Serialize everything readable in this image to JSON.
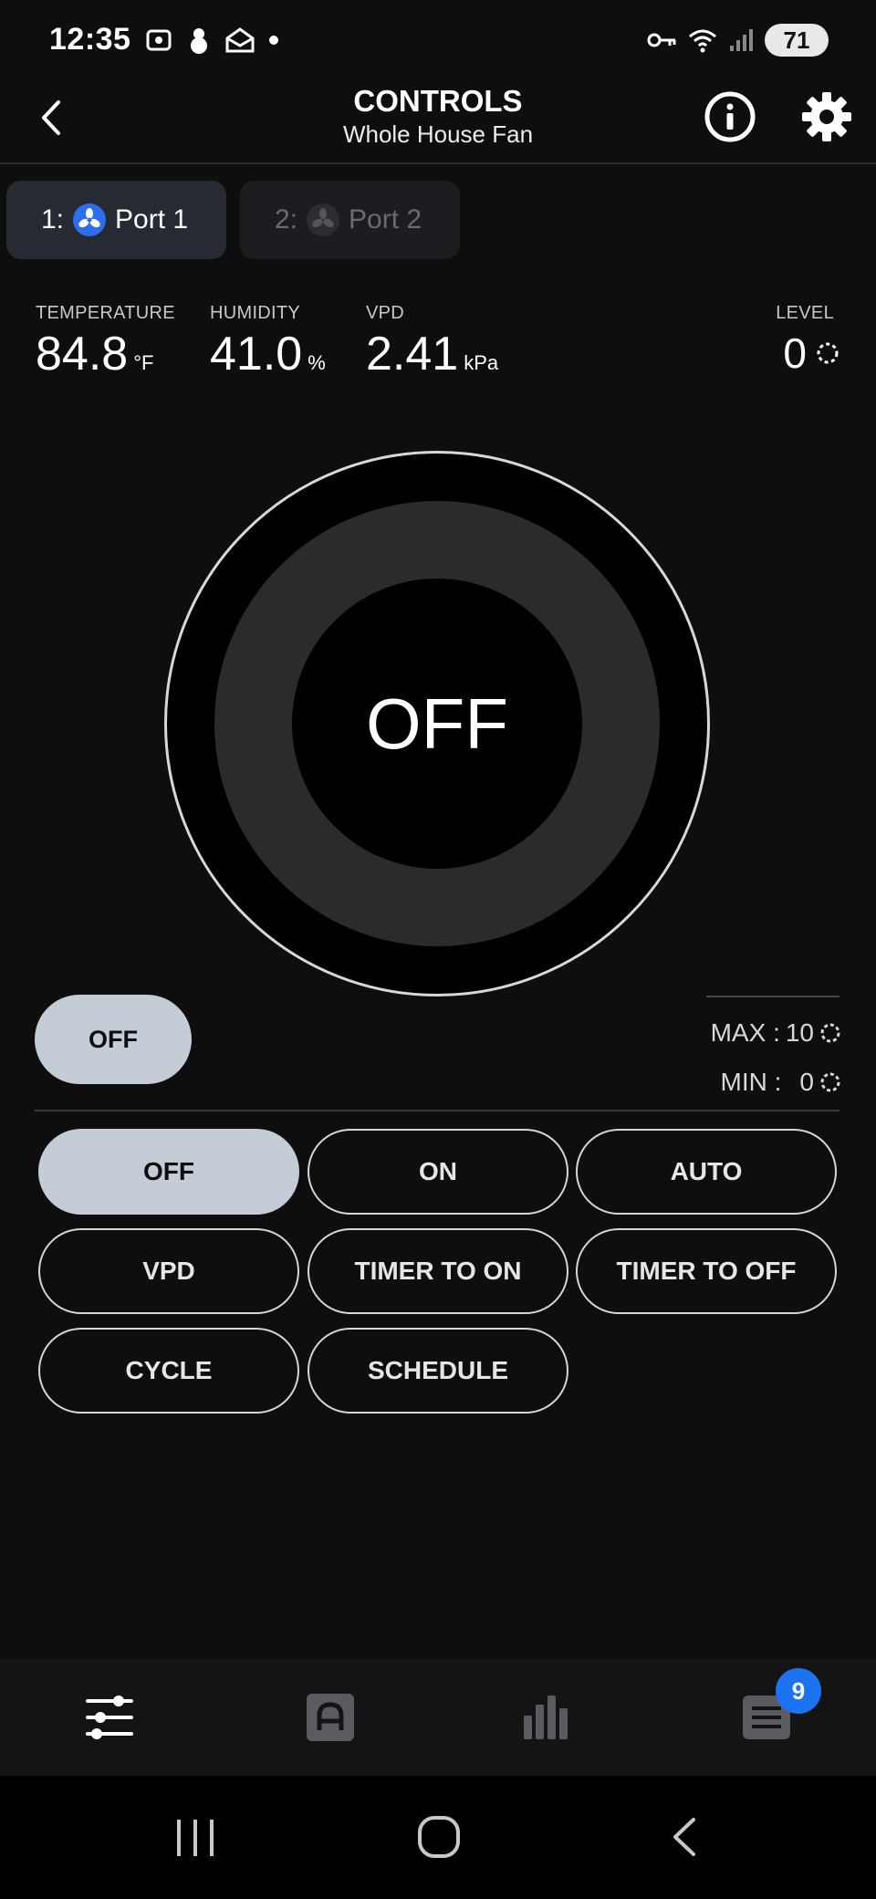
{
  "status_bar": {
    "time": "12:35",
    "battery": "71"
  },
  "header": {
    "title": "CONTROLS",
    "subtitle": "Whole House Fan"
  },
  "tabs": [
    {
      "index": "1:",
      "label": "Port 1",
      "active": true
    },
    {
      "index": "2:",
      "label": "Port 2",
      "active": false
    }
  ],
  "readings": {
    "temperature": {
      "label": "TEMPERATURE",
      "value": "84.8",
      "unit": "°F"
    },
    "humidity": {
      "label": "HUMIDITY",
      "value": "41.0",
      "unit": "%"
    },
    "vpd": {
      "label": "VPD",
      "value": "2.41",
      "unit": "kPa"
    },
    "level": {
      "label": "LEVEL",
      "value": "0"
    }
  },
  "dial": {
    "state": "OFF"
  },
  "current_mode_pill": "OFF",
  "limits": {
    "max_label": "MAX :",
    "max_value": "10",
    "min_label": "MIN :",
    "min_value": "0"
  },
  "modes": [
    {
      "label": "OFF",
      "active": true
    },
    {
      "label": "ON",
      "active": false
    },
    {
      "label": "AUTO",
      "active": false
    },
    {
      "label": "VPD",
      "active": false
    },
    {
      "label": "TIMER TO ON",
      "active": false
    },
    {
      "label": "TIMER TO OFF",
      "active": false
    },
    {
      "label": "CYCLE",
      "active": false
    },
    {
      "label": "SCHEDULE",
      "active": false
    }
  ],
  "bottom_nav": {
    "items": [
      "controls-icon",
      "automation-icon",
      "chart-icon",
      "notifications-icon"
    ],
    "badge": "9"
  },
  "colors": {
    "accent_blue": "#2f6df0",
    "active_fill": "#c4ccd6",
    "badge": "#1a73f0"
  }
}
